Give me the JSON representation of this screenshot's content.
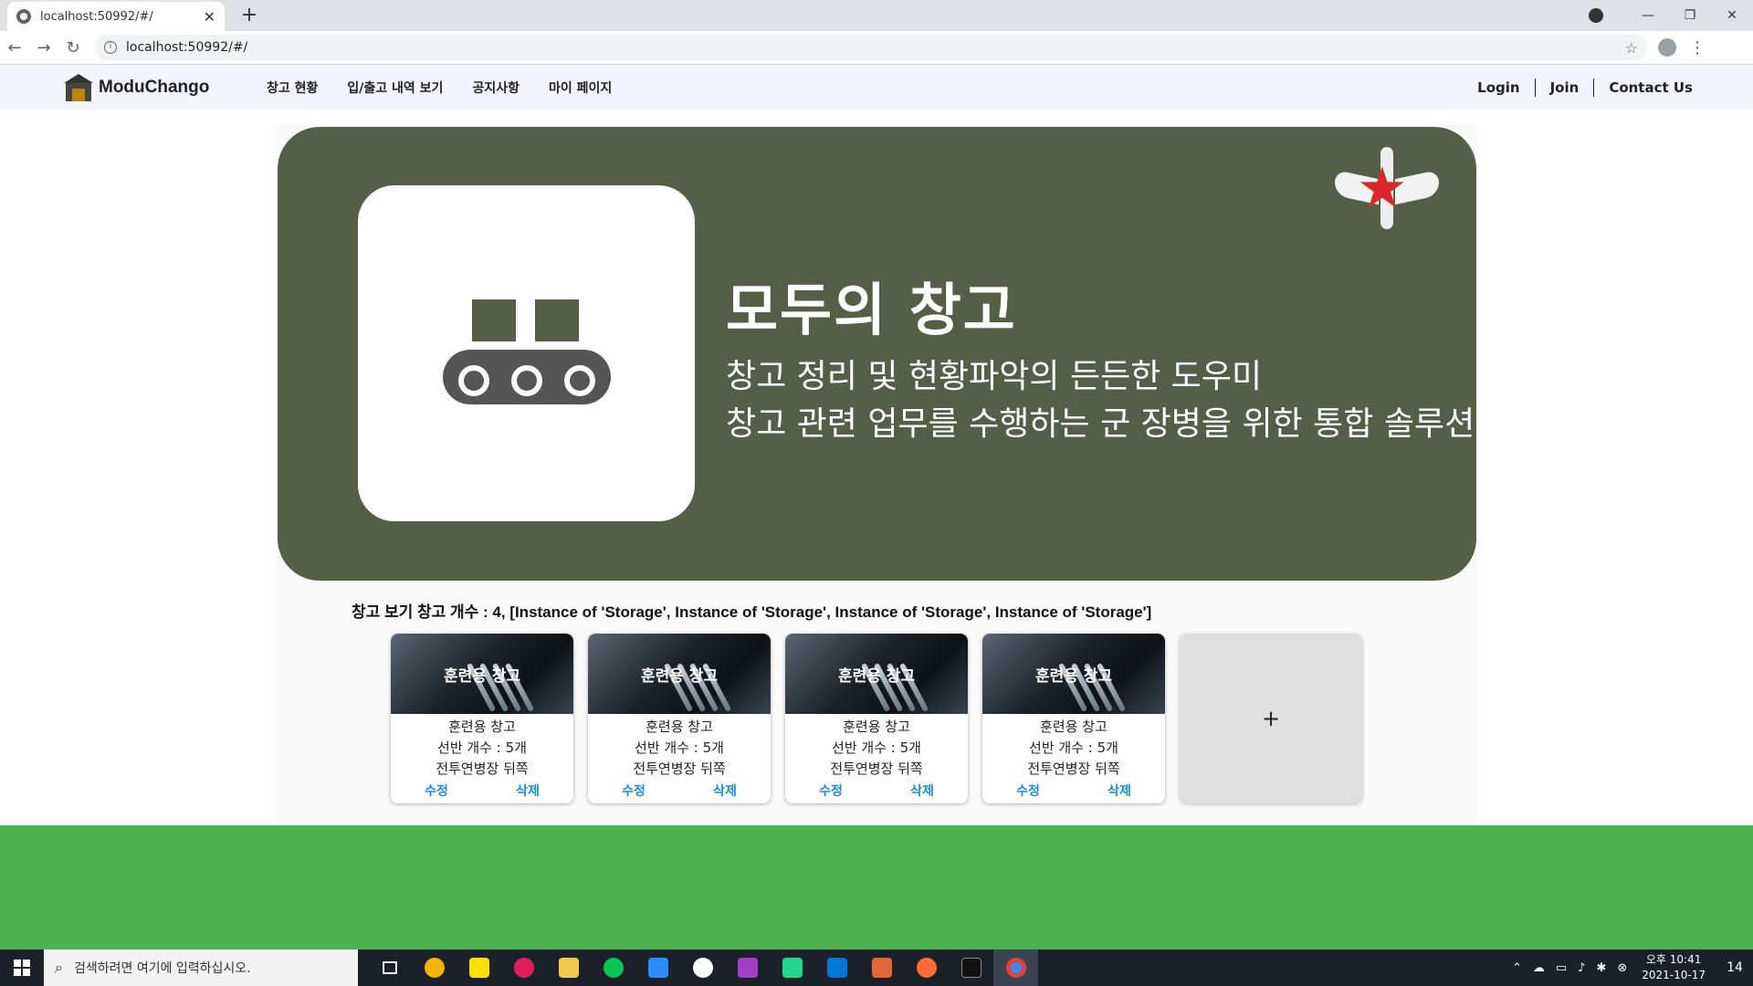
{
  "browser": {
    "tab_title": "localhost:50992/#/",
    "tab_close": "✕",
    "new_tab": "+",
    "url": "localhost:50992/#/",
    "back": "←",
    "forward": "→",
    "reload": "↻",
    "star": "☆",
    "menu": "⋮",
    "minimize": "—",
    "maximize": "❐",
    "close": "✕"
  },
  "navbar": {
    "brand": "ModuChango",
    "menu": [
      "창고 현황",
      "입/출고 내역 보기",
      "공지사항",
      "마이 페이지"
    ],
    "login": "Login",
    "join": "Join",
    "contact": "Contact Us"
  },
  "hero": {
    "title": "모두의 창고",
    "subtitle_line1": "창고 정리 및 현황파악의 든든한 도우미",
    "subtitle_line2": "창고 관련 업무를 수행하는 군 장병을 위한 통합 솔루션",
    "bg_color": "#555f47"
  },
  "summary": "창고 보기 창고 개수 : 4, [Instance of 'Storage', Instance of 'Storage', Instance of 'Storage', Instance of 'Storage']",
  "cards": [
    {
      "thumb_title": "훈련용 창고",
      "name": "훈련용 창고",
      "shelves": "선반 개수 : 5개",
      "location": "전투연병장 뒤쪽",
      "edit": "수정",
      "delete": "삭제"
    },
    {
      "thumb_title": "훈련용 창고",
      "name": "훈련용 창고",
      "shelves": "선반 개수 : 5개",
      "location": "전투연병장 뒤쪽",
      "edit": "수정",
      "delete": "삭제"
    },
    {
      "thumb_title": "훈련용 창고",
      "name": "훈련용 창고",
      "shelves": "선반 개수 : 5개",
      "location": "전투연병장 뒤쪽",
      "edit": "수정",
      "delete": "삭제"
    },
    {
      "thumb_title": "훈련용 창고",
      "name": "훈련용 창고",
      "shelves": "선반 개수 : 5개",
      "location": "전투연병장 뒤쪽",
      "edit": "수정",
      "delete": "삭제"
    }
  ],
  "add_card": "+",
  "colors": {
    "accent_link": "#1a8fd6",
    "footer_green": "#4caf50"
  },
  "taskbar": {
    "search_placeholder": "검색하려면 여기에 입력하십시오.",
    "time": "오후 10:41",
    "date": "2021-10-17",
    "notification_count": "14",
    "apps": [
      "task-view",
      "chrome-canary",
      "kakaotalk",
      "slack",
      "file-explorer",
      "line",
      "zoom",
      "word",
      "intellij",
      "pycharm",
      "vscode",
      "matlab",
      "postman",
      "terminal",
      "chrome"
    ]
  }
}
